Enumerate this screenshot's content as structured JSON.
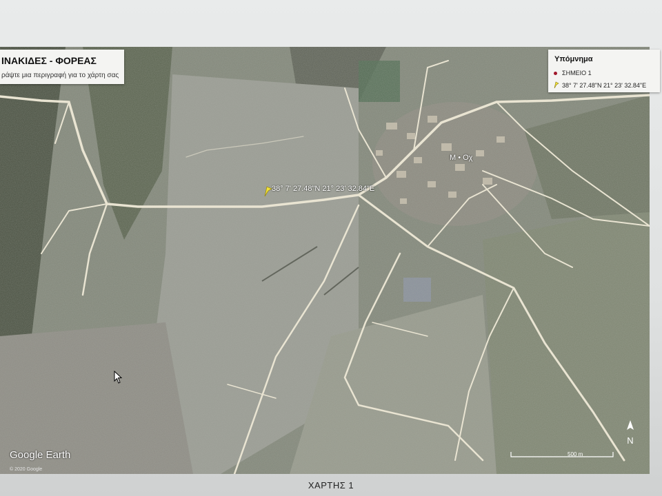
{
  "map_title": "ΙΝΑΚΙΔΕΣ - ΦΟΡΕΑΣ",
  "map_description": "ράψτε μια περιγραφή για το χάρτη σας",
  "legend": {
    "title": "Υπόμνημα",
    "items": [
      {
        "label": "ΣΗΜΕΙΟ 1",
        "icon": "red-dot-icon"
      },
      {
        "label": "38° 7' 27.48\"N 21° 23' 32.84\"E",
        "icon": "yellow-pin-icon"
      }
    ]
  },
  "place_label": "Μ • Οχ",
  "coord_label": "38° 7' 27.48\"N 21° 23' 32.84\"E",
  "logo": "Google Earth",
  "copyright": "© 2020 Google",
  "scale_label": "500 m",
  "compass_label": "N",
  "caption": "ΧΑΡΤΗΣ 1",
  "colors": {
    "pin": "#f2e23a",
    "dot": "#a0172b",
    "roads": "#e9e4d2"
  }
}
